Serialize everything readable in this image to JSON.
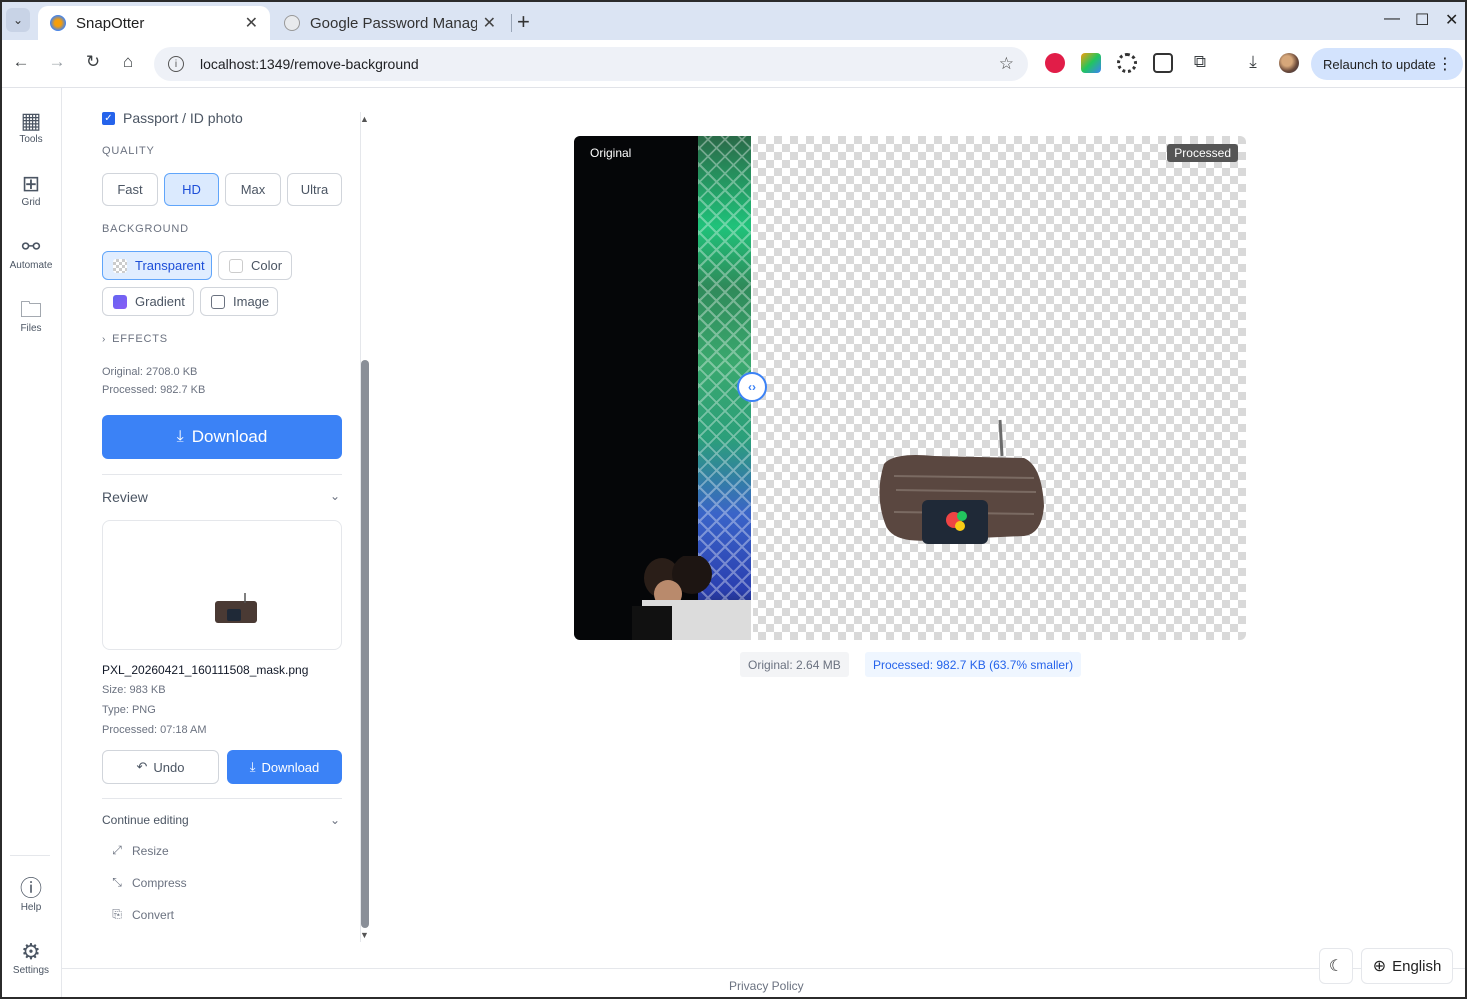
{
  "browser": {
    "tabs": [
      {
        "title": "SnapOtter",
        "active": true
      },
      {
        "title": "Google Password Manag",
        "active": false
      }
    ],
    "url": "localhost:1349/remove-background",
    "relaunch_label": "Relaunch to update"
  },
  "rail": {
    "items": [
      {
        "label": "Tools",
        "icon": "grid-icon"
      },
      {
        "label": "Grid",
        "icon": "table-icon"
      },
      {
        "label": "Automate",
        "icon": "workflow-icon"
      },
      {
        "label": "Files",
        "icon": "folder-icon"
      }
    ],
    "bottom": [
      {
        "label": "Help",
        "icon": "help-icon"
      },
      {
        "label": "Settings",
        "icon": "gear-icon"
      }
    ]
  },
  "panel": {
    "passport_label": "Passport / ID photo",
    "passport_checked": true,
    "quality_label": "QUALITY",
    "quality_options": [
      "Fast",
      "HD",
      "Max",
      "Ultra"
    ],
    "quality_selected": "HD",
    "background_label": "BACKGROUND",
    "background_options": [
      "Transparent",
      "Color",
      "Gradient",
      "Image"
    ],
    "background_selected": "Transparent",
    "effects_label": "EFFECTS",
    "original_size": "Original: 2708.0 KB",
    "processed_size": "Processed: 982.7 KB",
    "download_label": "Download",
    "review_label": "Review",
    "file": {
      "name": "PXL_20260421_160111508_mask.png",
      "size": "Size: 983 KB",
      "type": "Type: PNG",
      "processed": "Processed: 07:18 AM"
    },
    "undo_label": "Undo",
    "download_small_label": "Download",
    "continue_label": "Continue editing",
    "continue_items": [
      "Resize",
      "Compress",
      "Convert"
    ]
  },
  "viewer": {
    "original_tag": "Original",
    "processed_tag": "Processed",
    "stat_original": "Original: 2.64 MB",
    "stat_processed": "Processed: 982.7 KB (63.7% smaller)"
  },
  "footer": {
    "privacy": "Privacy Policy",
    "language": "English"
  },
  "colors": {
    "accent": "#3b82f6",
    "selected_bg": "#dbeafe"
  }
}
